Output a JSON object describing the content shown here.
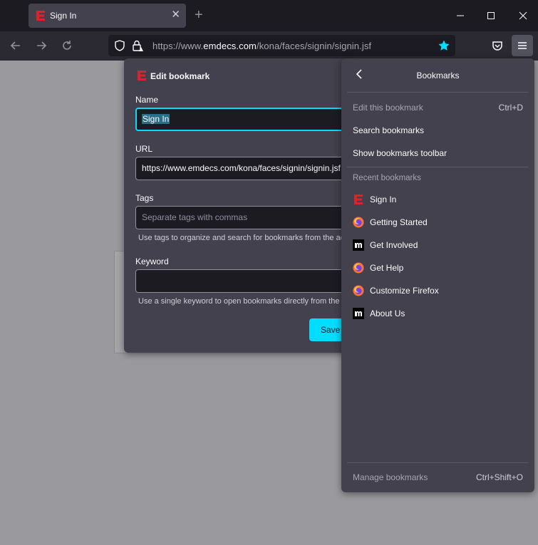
{
  "tab": {
    "title": "Sign In",
    "close": "✕",
    "new": "+"
  },
  "url": {
    "prefix": "https://www.",
    "domain": "emdecs.com",
    "path": "/kona/faces/signin/signin.jsf"
  },
  "edit_bookmark": {
    "title": "Edit bookmark",
    "name_label": "Name",
    "name_value": "Sign In",
    "url_label": "URL",
    "url_value": "https://www.emdecs.com/kona/faces/signin/signin.jsf",
    "tags_label": "Tags",
    "tags_placeholder": "Separate tags with commas",
    "tags_hint": "Use tags to organize and search for bookmarks from the address bar.",
    "keyword_label": "Keyword",
    "keyword_value": "",
    "keyword_hint": "Use a single keyword to open bookmarks directly from the address bar.",
    "save_label": "Save"
  },
  "bookmarks_panel": {
    "title": "Bookmarks",
    "edit_this": "Edit this bookmark",
    "edit_this_shortcut": "Ctrl+D",
    "search": "Search bookmarks",
    "show_toolbar": "Show bookmarks toolbar",
    "recent_label": "Recent bookmarks",
    "recent": [
      {
        "label": "Sign In",
        "icon": "emdecs-logo-icon"
      },
      {
        "label": "Getting Started",
        "icon": "firefox-icon"
      },
      {
        "label": "Get Involved",
        "icon": "mozilla-icon"
      },
      {
        "label": "Get Help",
        "icon": "firefox-icon"
      },
      {
        "label": "Customize Firefox",
        "icon": "firefox-icon"
      },
      {
        "label": "About Us",
        "icon": "mozilla-icon"
      }
    ],
    "manage": "Manage bookmarks",
    "manage_shortcut": "Ctrl+Shift+O"
  },
  "colors": {
    "accent": "#00ddff",
    "star": "#00ddff",
    "brand_red": "#e0202a"
  }
}
